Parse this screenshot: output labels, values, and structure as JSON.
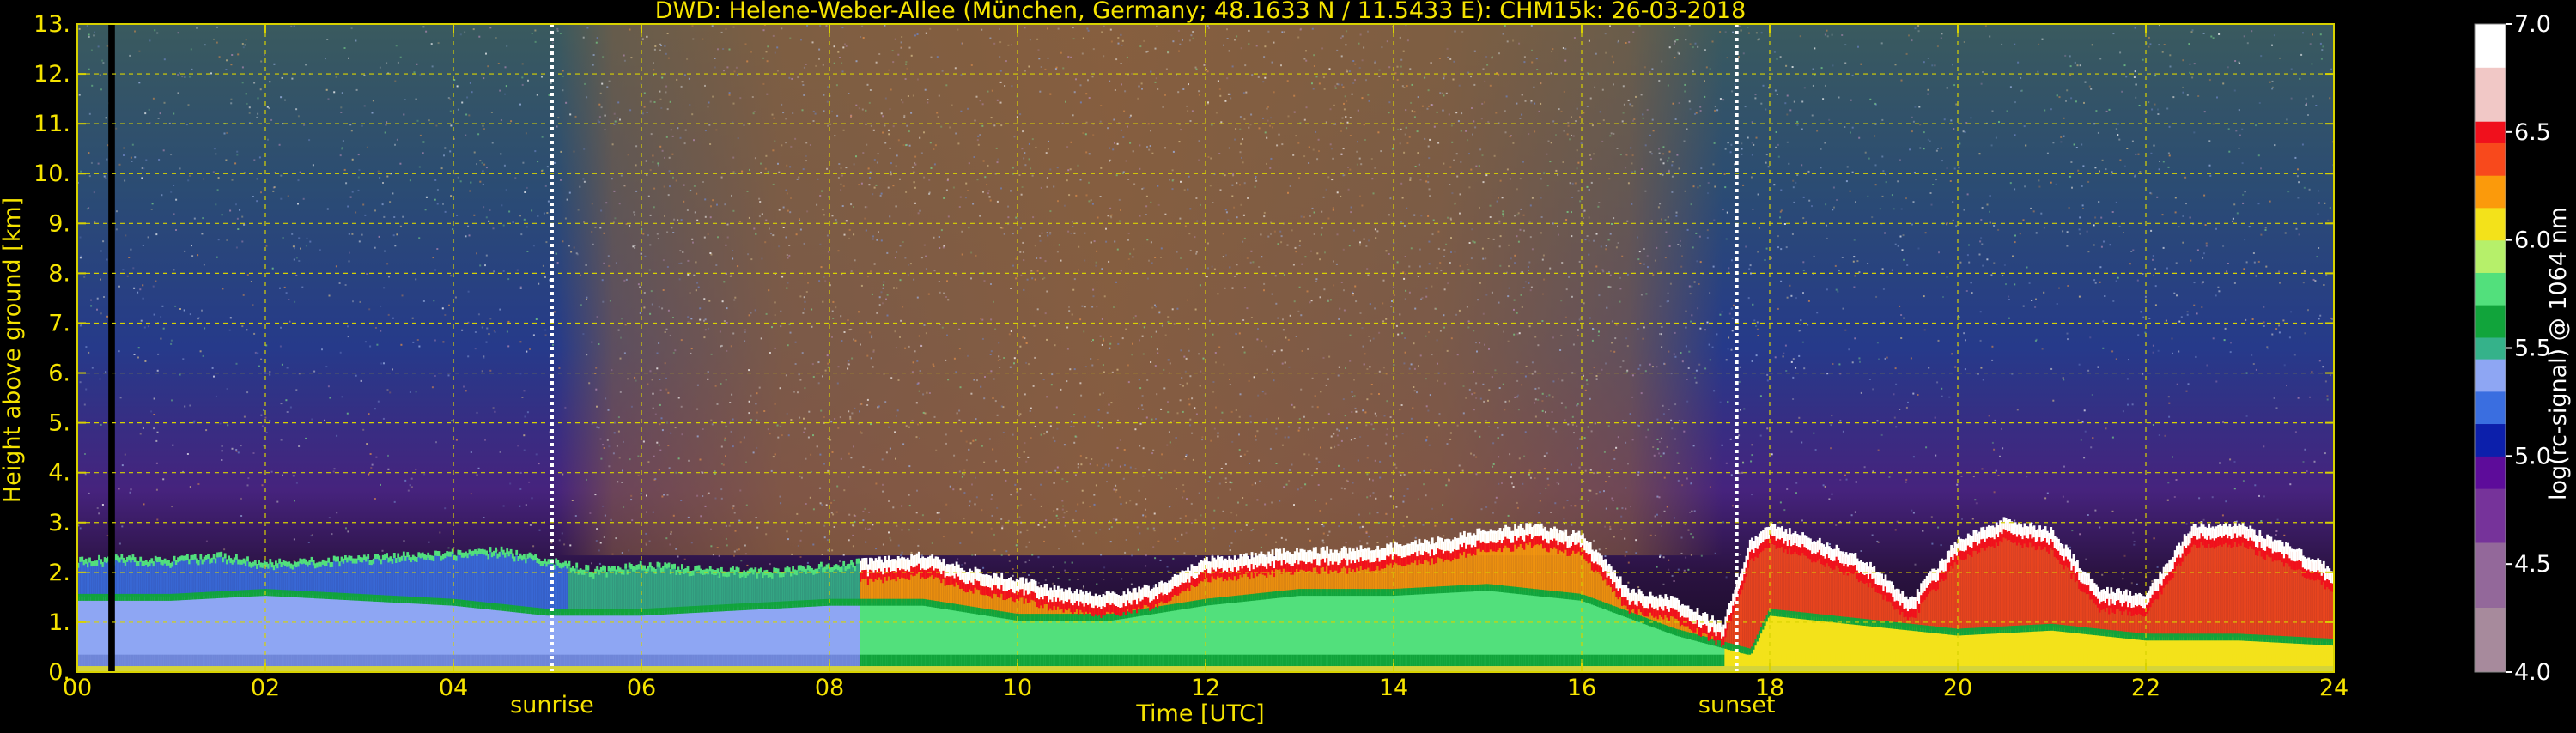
{
  "chart_data": {
    "type": "heatmap",
    "title": "DWD: Helene-Weber-Allee (München, Germany; 48.1633 N / 11.5433 E):    CHM15k: 26-03-2018",
    "xlabel": "Time [UTC]",
    "ylabel": "Height above ground [km]",
    "xlim": [
      0,
      24
    ],
    "ylim": [
      0,
      13
    ],
    "x_ticks": [
      {
        "value": 0,
        "label": "00"
      },
      {
        "value": 2,
        "label": "02"
      },
      {
        "value": 4,
        "label": "04"
      },
      {
        "value": 6,
        "label": "06"
      },
      {
        "value": 8,
        "label": "08"
      },
      {
        "value": 10,
        "label": "10"
      },
      {
        "value": 12,
        "label": "12"
      },
      {
        "value": 14,
        "label": "14"
      },
      {
        "value": 16,
        "label": "16"
      },
      {
        "value": 18,
        "label": "18"
      },
      {
        "value": 20,
        "label": "20"
      },
      {
        "value": 22,
        "label": "22"
      },
      {
        "value": 24,
        "label": "24"
      }
    ],
    "y_ticks": [
      {
        "value": 0,
        "label": "0."
      },
      {
        "value": 1,
        "label": "1."
      },
      {
        "value": 2,
        "label": "2."
      },
      {
        "value": 3,
        "label": "3."
      },
      {
        "value": 4,
        "label": "4."
      },
      {
        "value": 5,
        "label": "5."
      },
      {
        "value": 6,
        "label": "6."
      },
      {
        "value": 7,
        "label": "7."
      },
      {
        "value": 8,
        "label": "8."
      },
      {
        "value": 9,
        "label": "9."
      },
      {
        "value": 10,
        "label": "10."
      },
      {
        "value": 11,
        "label": "11."
      },
      {
        "value": 12,
        "label": "12."
      },
      {
        "value": 13,
        "label": "13."
      }
    ],
    "grid": true,
    "markers": [
      {
        "name": "sunrise",
        "label": "sunrise",
        "time": 5.05
      },
      {
        "name": "sunset",
        "label": "sunset",
        "time": 17.65
      }
    ],
    "colorbar": {
      "label": "log(rc-signal) @ 1064 nm",
      "range": [
        4.0,
        7.0
      ],
      "ticks": [
        {
          "value": 4.0,
          "label": "4.0"
        },
        {
          "value": 4.5,
          "label": "4.5"
        },
        {
          "value": 5.0,
          "label": "5.0"
        },
        {
          "value": 5.5,
          "label": "5.5"
        },
        {
          "value": 6.0,
          "label": "6.0"
        },
        {
          "value": 6.5,
          "label": "6.5"
        },
        {
          "value": 7.0,
          "label": "7.0"
        }
      ],
      "stops": [
        {
          "value": 4.0,
          "color": "#a78a9c"
        },
        {
          "value": 4.3,
          "color": "#93689a"
        },
        {
          "value": 4.6,
          "color": "#76339a"
        },
        {
          "value": 4.85,
          "color": "#5d0c9a"
        },
        {
          "value": 5.0,
          "color": "#0c1fab"
        },
        {
          "value": 5.15,
          "color": "#3a6ee0"
        },
        {
          "value": 5.3,
          "color": "#8ea6f3"
        },
        {
          "value": 5.45,
          "color": "#35b28a"
        },
        {
          "value": 5.55,
          "color": "#11a43b"
        },
        {
          "value": 5.7,
          "color": "#52e07c"
        },
        {
          "value": 5.85,
          "color": "#b6f06a"
        },
        {
          "value": 6.0,
          "color": "#f3e21a"
        },
        {
          "value": 6.15,
          "color": "#fb9a0b"
        },
        {
          "value": 6.3,
          "color": "#f8491c"
        },
        {
          "value": 6.45,
          "color": "#f0101c"
        },
        {
          "value": 6.55,
          "color": "#f1c8c6"
        },
        {
          "value": 6.8,
          "color": "#ffffff"
        },
        {
          "value": 7.0,
          "color": "#ffffff"
        }
      ]
    },
    "data_gaps": [
      {
        "from": 0.33,
        "to": 0.4
      }
    ],
    "layers": [
      {
        "name": "cloud-top-height",
        "unit": "km",
        "x": [
          0,
          0.5,
          1,
          1.5,
          2,
          2.5,
          3,
          3.5,
          4,
          4.5,
          5,
          5.5,
          6,
          6.5,
          7,
          7.5,
          8,
          8.5,
          9,
          9.5,
          10,
          10.5,
          11,
          11.5,
          12,
          12.5,
          13,
          13.5,
          14,
          14.5,
          15,
          15.5,
          16,
          16.5,
          17,
          17.5,
          17.8,
          18,
          18.5,
          19,
          19.5,
          20,
          20.5,
          21,
          21.5,
          22,
          22.5,
          23,
          23.5,
          24
        ],
        "y": [
          2.2,
          2.25,
          2.2,
          2.3,
          2.15,
          2.2,
          2.25,
          2.3,
          2.35,
          2.4,
          2.2,
          2.0,
          2.1,
          2.05,
          2.0,
          2.0,
          2.1,
          2.2,
          2.3,
          2.0,
          1.8,
          1.6,
          1.5,
          1.7,
          2.2,
          2.3,
          2.4,
          2.4,
          2.5,
          2.6,
          2.8,
          2.9,
          2.7,
          1.6,
          1.4,
          0.9,
          2.6,
          2.9,
          2.6,
          2.2,
          1.4,
          2.6,
          3.0,
          2.8,
          1.6,
          1.5,
          2.9,
          2.9,
          2.5,
          2.0
        ]
      },
      {
        "name": "boundary-layer-top",
        "unit": "km",
        "x": [
          0,
          1,
          2,
          3,
          4,
          5,
          6,
          7,
          8,
          9,
          10,
          11,
          12,
          13,
          14,
          15,
          16,
          17,
          17.8,
          18,
          19,
          20,
          21,
          22,
          23,
          24
        ],
        "y": [
          1.5,
          1.5,
          1.6,
          1.5,
          1.4,
          1.2,
          1.2,
          1.3,
          1.4,
          1.4,
          1.1,
          1.1,
          1.4,
          1.6,
          1.6,
          1.7,
          1.5,
          0.8,
          0.4,
          1.2,
          1.0,
          0.8,
          0.9,
          0.7,
          0.7,
          0.6
        ]
      }
    ]
  }
}
